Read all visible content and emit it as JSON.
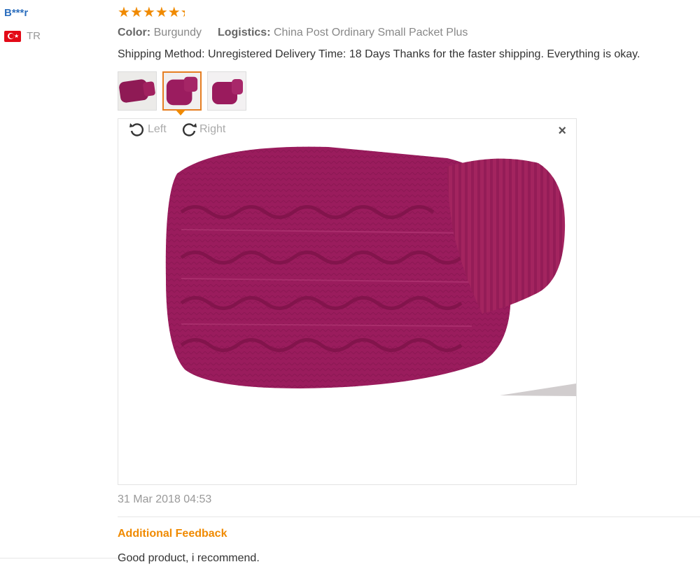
{
  "review": {
    "user_name": "B***r",
    "country_code": "TR",
    "rating": 4.8,
    "attributes": [
      {
        "label": "Color:",
        "value": "Burgundy"
      },
      {
        "label": "Logistics:",
        "value": "China Post Ordinary Small Packet Plus"
      }
    ],
    "text": "Shipping Method: Unregistered Delivery Time: 18 Days Thanks for the faster shipping. Everything is okay.",
    "date": "31 Mar 2018 04:53",
    "additional_feedback_label": "Additional Feedback",
    "additional_feedback_text": "Good product, i recommend."
  },
  "viewer": {
    "rotate_left_label": "Left",
    "rotate_right_label": "Right",
    "close_symbol": "×",
    "thumbnail_count": 3,
    "active_thumbnail": 2
  },
  "icons": {
    "star": "star-icon",
    "rotate_left": "rotate-left-icon",
    "rotate_right": "rotate-right-icon",
    "close": "close-icon",
    "flag": "turkey-flag-icon"
  },
  "colors": {
    "accent": "#f08a00",
    "username": "#2d6fbe",
    "product": "#9c1a5e"
  }
}
